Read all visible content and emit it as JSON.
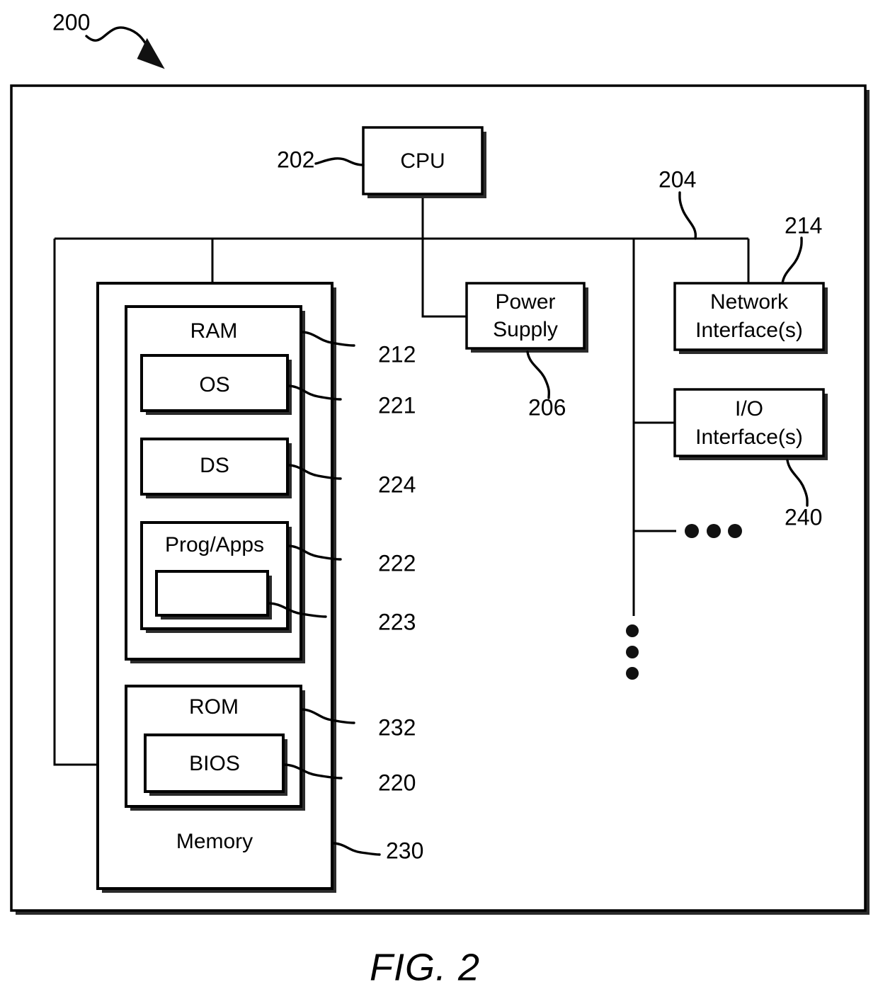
{
  "figure": {
    "caption": "FIG. 2",
    "figure_ref": "200"
  },
  "blocks": {
    "cpu": {
      "label": "CPU",
      "ref": "202"
    },
    "power_supply": {
      "label_line1": "Power",
      "label_line2": "Supply",
      "ref": "206"
    },
    "network_interface": {
      "label_line1": "Network",
      "label_line2": "Interface(s)",
      "ref": "214"
    },
    "io_interface": {
      "label_line1": "I/O",
      "label_line2": "Interface(s)",
      "ref": "240"
    },
    "memory": {
      "label": "Memory",
      "ref": "230"
    },
    "ram": {
      "label": "RAM",
      "ref": "212"
    },
    "os": {
      "label": "OS",
      "ref": "221"
    },
    "ds": {
      "label": "DS",
      "ref": "224"
    },
    "prog_apps": {
      "label": "Prog/Apps",
      "ref": "222"
    },
    "prog_apps_inner": {
      "label": "",
      "ref": "223"
    },
    "rom": {
      "label": "ROM",
      "ref": "232"
    },
    "bios": {
      "label": "BIOS",
      "ref": "220"
    }
  },
  "bus": {
    "ref": "204"
  },
  "colors": {
    "line": "#000000",
    "shadow": "#2b2b2b",
    "background": "#ffffff"
  }
}
